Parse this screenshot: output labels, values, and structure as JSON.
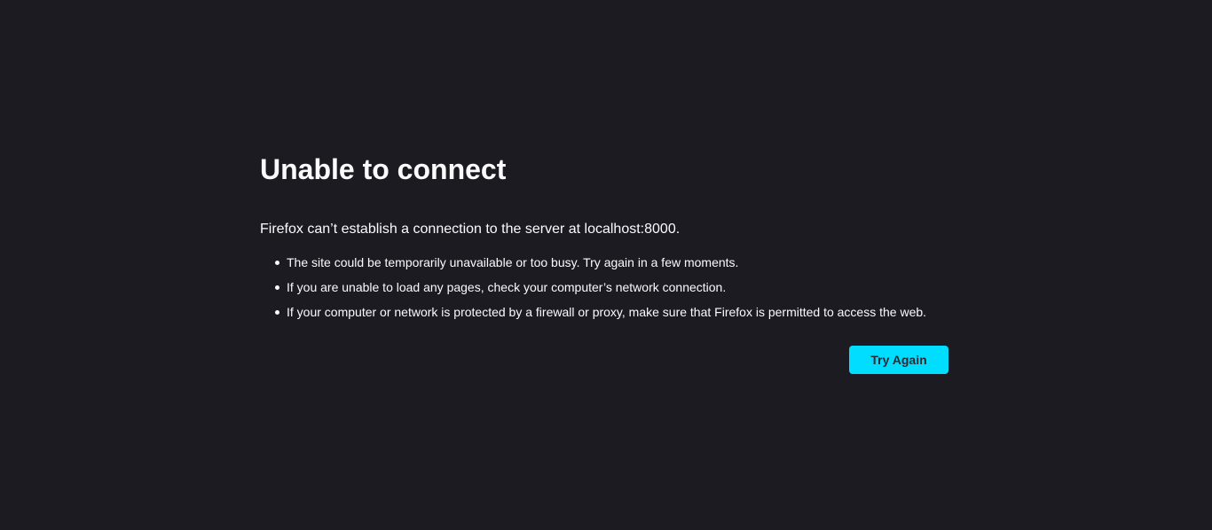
{
  "error": {
    "title": "Unable to connect",
    "description": "Firefox can’t establish a connection to the server at localhost:8000.",
    "bullets": [
      "The site could be temporarily unavailable or too busy. Try again in a few moments.",
      "If you are unable to load any pages, check your computer’s network connection.",
      "If your computer or network is protected by a firewall or proxy, make sure that Firefox is permitted to access the web."
    ],
    "try_again_label": "Try Again"
  },
  "colors": {
    "background": "#1c1b22",
    "text": "#fbfbfe",
    "accent": "#00ddff"
  }
}
